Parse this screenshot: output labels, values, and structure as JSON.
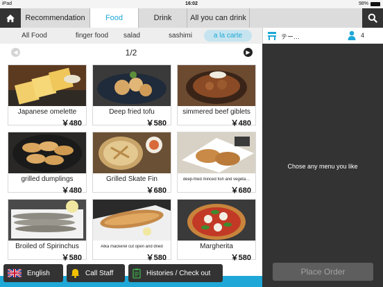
{
  "status_bar": {
    "device": "iPad",
    "time": "16:02",
    "battery": "98%",
    "battery_level": 0.98
  },
  "nav": {
    "tabs": [
      {
        "label": "Recommendation",
        "active": false
      },
      {
        "label": "Food",
        "active": true
      },
      {
        "label": "Drink",
        "active": false
      },
      {
        "label": "All you can drink",
        "active": false
      }
    ]
  },
  "subtabs": [
    {
      "label": "All Food",
      "active": false
    },
    {
      "label": "finger food",
      "active": false
    },
    {
      "label": "salad",
      "active": false
    },
    {
      "label": "sashimi",
      "active": false
    },
    {
      "label": "a la carte",
      "active": true
    }
  ],
  "pager": {
    "label": "1/2"
  },
  "menu_items": [
    {
      "name": "Japanese omelette",
      "price": "￥480"
    },
    {
      "name": "Deep fried tofu",
      "price": "￥580"
    },
    {
      "name": "simmered beef giblets",
      "price": "￥480"
    },
    {
      "name": "grilled dumplings",
      "price": "￥480"
    },
    {
      "name": "Grilled Skate Fin",
      "price": "￥680"
    },
    {
      "name": "deep-fried minced fish and vegeta…",
      "price": "￥680"
    },
    {
      "name": "Broiled of Spirinchus",
      "price": "￥580"
    },
    {
      "name": "Atka mackerel cut open and dried",
      "price": "￥580"
    },
    {
      "name": "Margherita",
      "price": "￥580"
    }
  ],
  "cart": {
    "table_name": "テー…",
    "guest_count": "4",
    "empty_message": "Chose any menu you like",
    "place_order_label": "Place Order"
  },
  "footer": {
    "language_label": "English",
    "call_staff_label": "Call Staff",
    "histories_label": "Histories / Check out"
  },
  "colors": {
    "accent": "#1ea7d7",
    "dark": "#333333"
  }
}
